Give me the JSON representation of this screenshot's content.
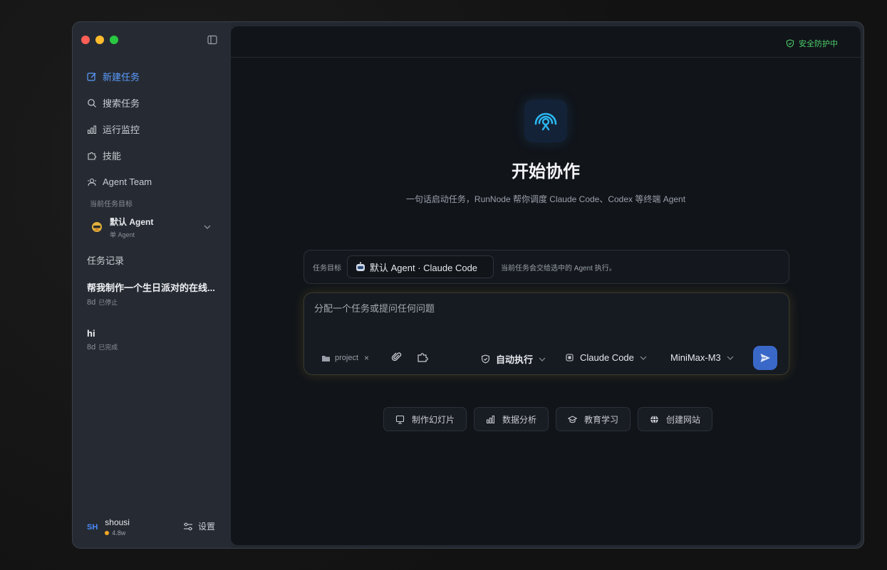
{
  "sidebar": {
    "nav": [
      {
        "label": "新建任务",
        "icon": "edit-icon",
        "active": true
      },
      {
        "label": "搜索任务",
        "icon": "search-icon"
      },
      {
        "label": "运行监控",
        "icon": "bar-chart-icon"
      },
      {
        "label": "技能",
        "icon": "puzzle-icon"
      },
      {
        "label": "Agent Team",
        "icon": "team-icon"
      }
    ],
    "current_target_label": "当前任务目标",
    "agent": {
      "name": "默认 Agent",
      "sub": "单 Agent"
    },
    "records_title": "任务记录",
    "records": [
      {
        "title": "帮我制作一个生日派对的在线...",
        "age": "8d",
        "status": "已停止"
      },
      {
        "title": "hi",
        "age": "8d",
        "status": "已完成"
      }
    ],
    "user": {
      "initials": "SH",
      "name": "shousi",
      "credit": "4.8w"
    },
    "settings_label": "设置"
  },
  "topbar": {
    "security_label": "安全防护中",
    "security_color": "#4ccf6a"
  },
  "hero": {
    "title": "开始协作",
    "subtitle": "一句话启动任务，RunNode 帮你调度 Claude Code、Codex 等终端 Agent"
  },
  "target_bar": {
    "label": "任务目标",
    "chip": "默认 Agent · Claude Code",
    "note": "当前任务会交给选中的 Agent 执行。"
  },
  "composer": {
    "placeholder": "分配一个任务或提问任何问题",
    "project": "project",
    "mode": "自动执行",
    "agent": "Claude Code",
    "model": "MiniMax-M3"
  },
  "quick_actions": [
    {
      "label": "制作幻灯片",
      "icon": "presentation-icon"
    },
    {
      "label": "数据分析",
      "icon": "bar-chart-icon"
    },
    {
      "label": "教育学习",
      "icon": "graduation-cap-icon"
    },
    {
      "label": "创建网站",
      "icon": "globe-icon"
    }
  ],
  "colors": {
    "accent": "#5b9dff",
    "send": "#3a68c8"
  }
}
